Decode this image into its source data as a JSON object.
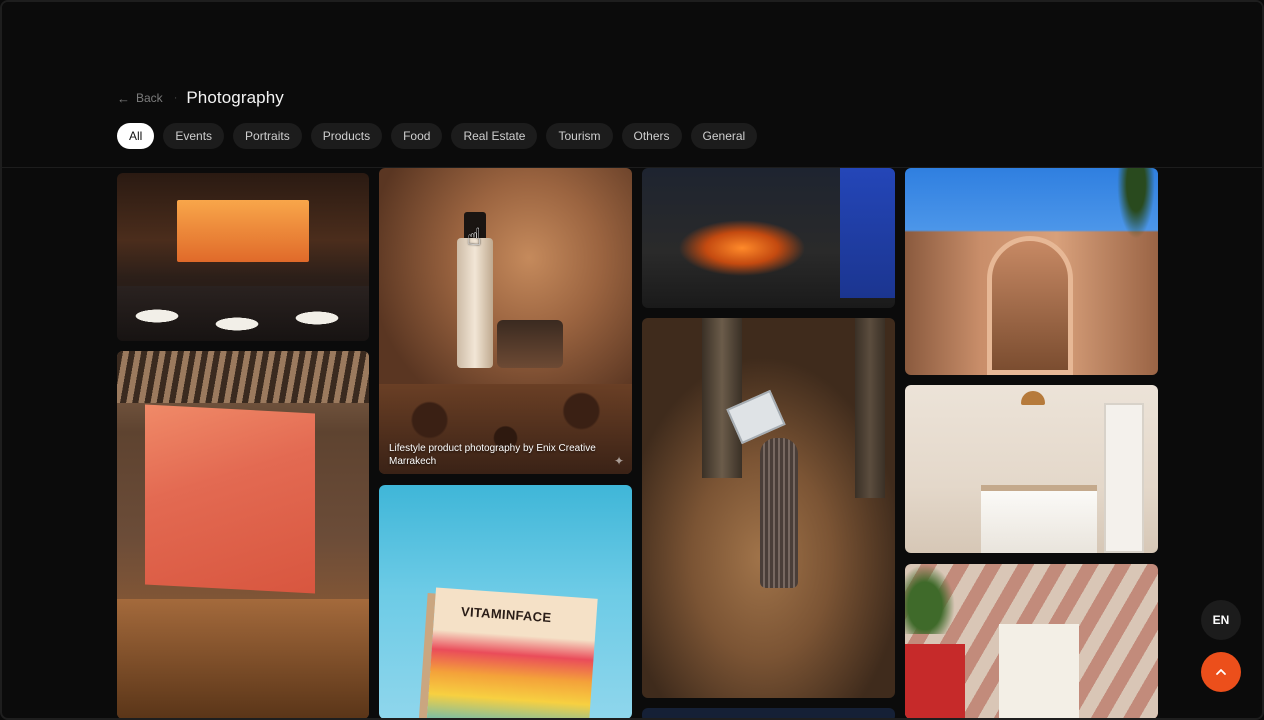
{
  "breadcrumb": {
    "back_label": "Back",
    "back_icon": "arrow-left-icon",
    "separator": "·",
    "title": "Photography"
  },
  "filters": [
    {
      "label": "All",
      "active": true
    },
    {
      "label": "Events",
      "active": false
    },
    {
      "label": "Portraits",
      "active": false
    },
    {
      "label": "Products",
      "active": false
    },
    {
      "label": "Food",
      "active": false
    },
    {
      "label": "Real Estate",
      "active": false
    },
    {
      "label": "Tourism",
      "active": false
    },
    {
      "label": "Others",
      "active": false
    },
    {
      "label": "General",
      "active": false
    }
  ],
  "gallery": {
    "hovered_caption": "Lifestyle product photography by Enix Creative Marrakech",
    "vitamin_brand": "VITAMINFACE"
  },
  "floating": {
    "language": "EN",
    "scroll_top_icon": "chevron-up-icon"
  },
  "colors": {
    "accent": "#ec4f1b",
    "background": "#0b0b0b",
    "chip": "#1c1c1c",
    "chip_active": "#ffffff"
  }
}
